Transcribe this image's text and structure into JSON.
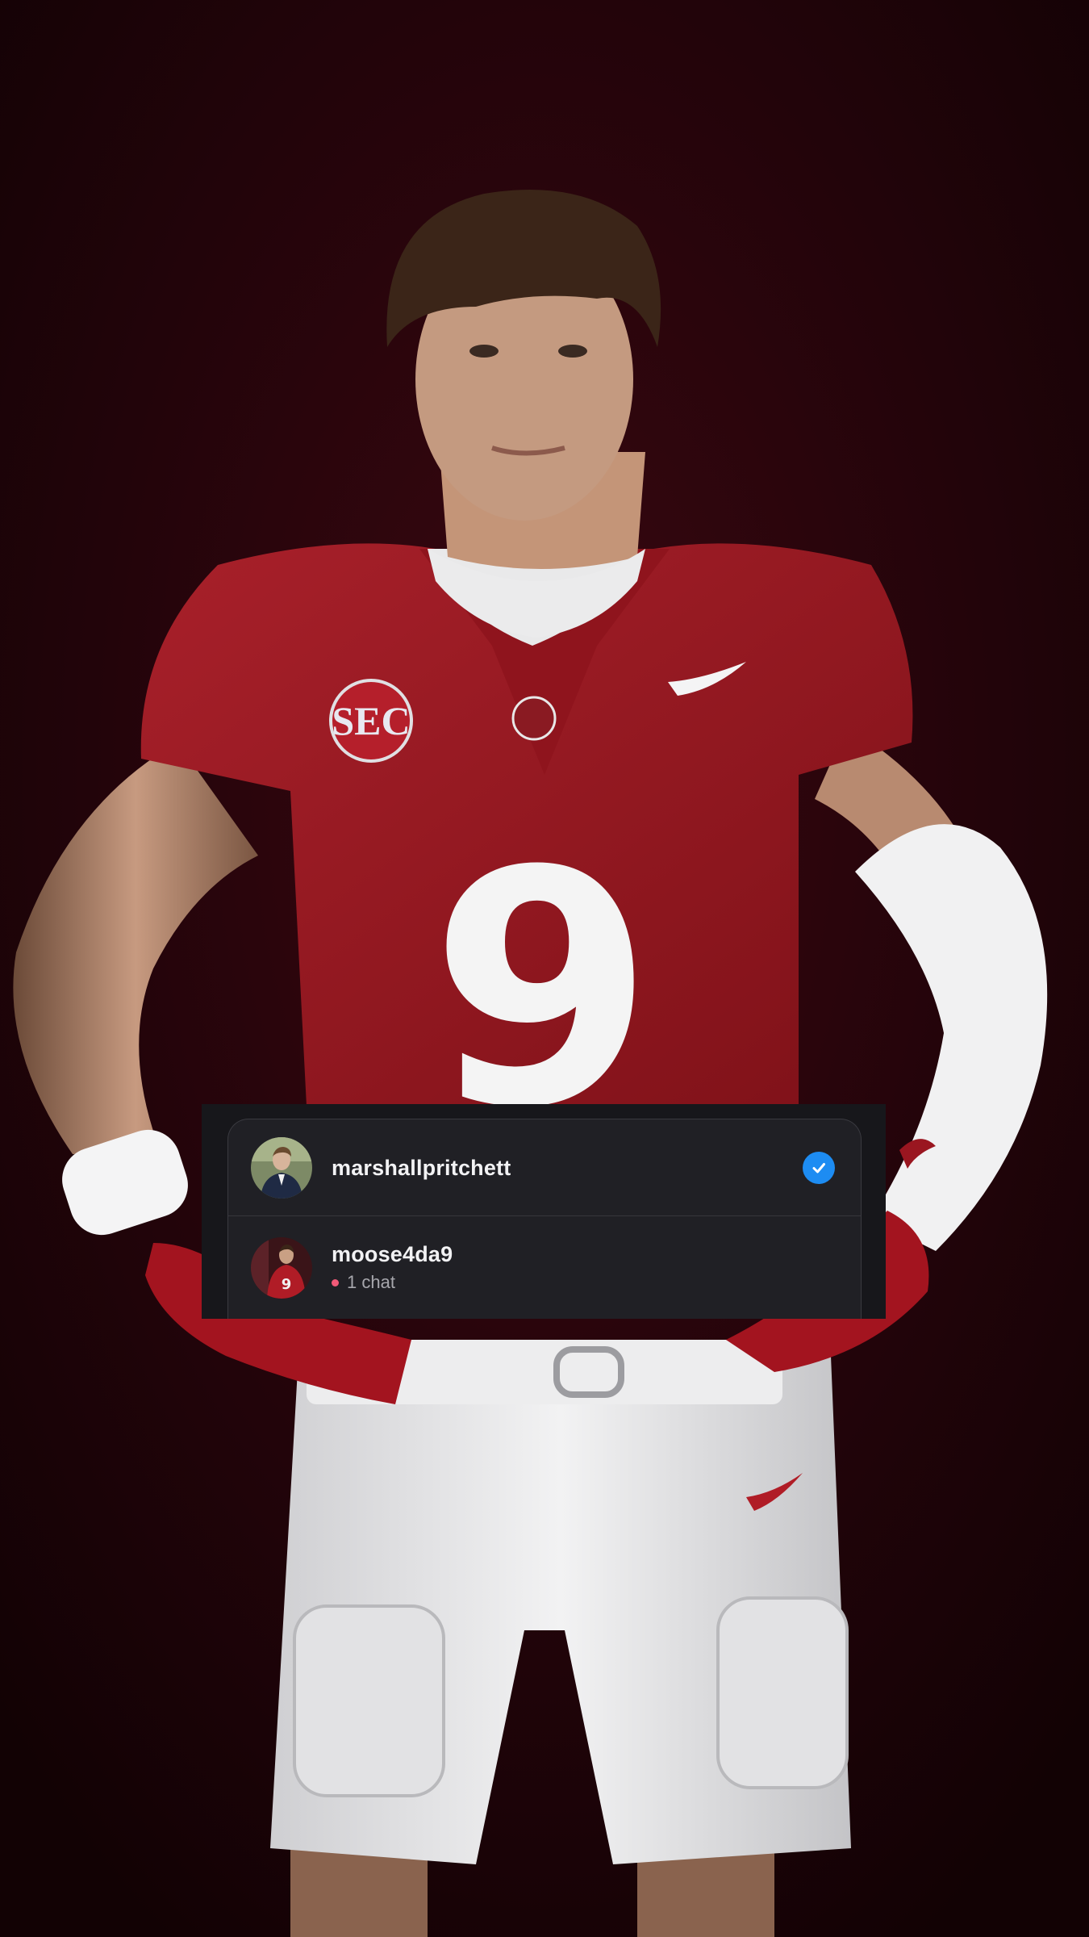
{
  "colors": {
    "background": "#1a0306",
    "jersey": "#9a1620",
    "overlay_bg": "#17171b",
    "card_bg": "#202025",
    "check": "#1d8cf2",
    "unread_dot": "#f25a78"
  },
  "jersey": {
    "number": "9",
    "patch": "SEC"
  },
  "accounts": [
    {
      "username": "marshallpritchett",
      "selected": true,
      "status_icon": "checkmark-circle-icon"
    },
    {
      "username": "moose4da9",
      "selected": false,
      "subtitle": "1 chat"
    }
  ]
}
